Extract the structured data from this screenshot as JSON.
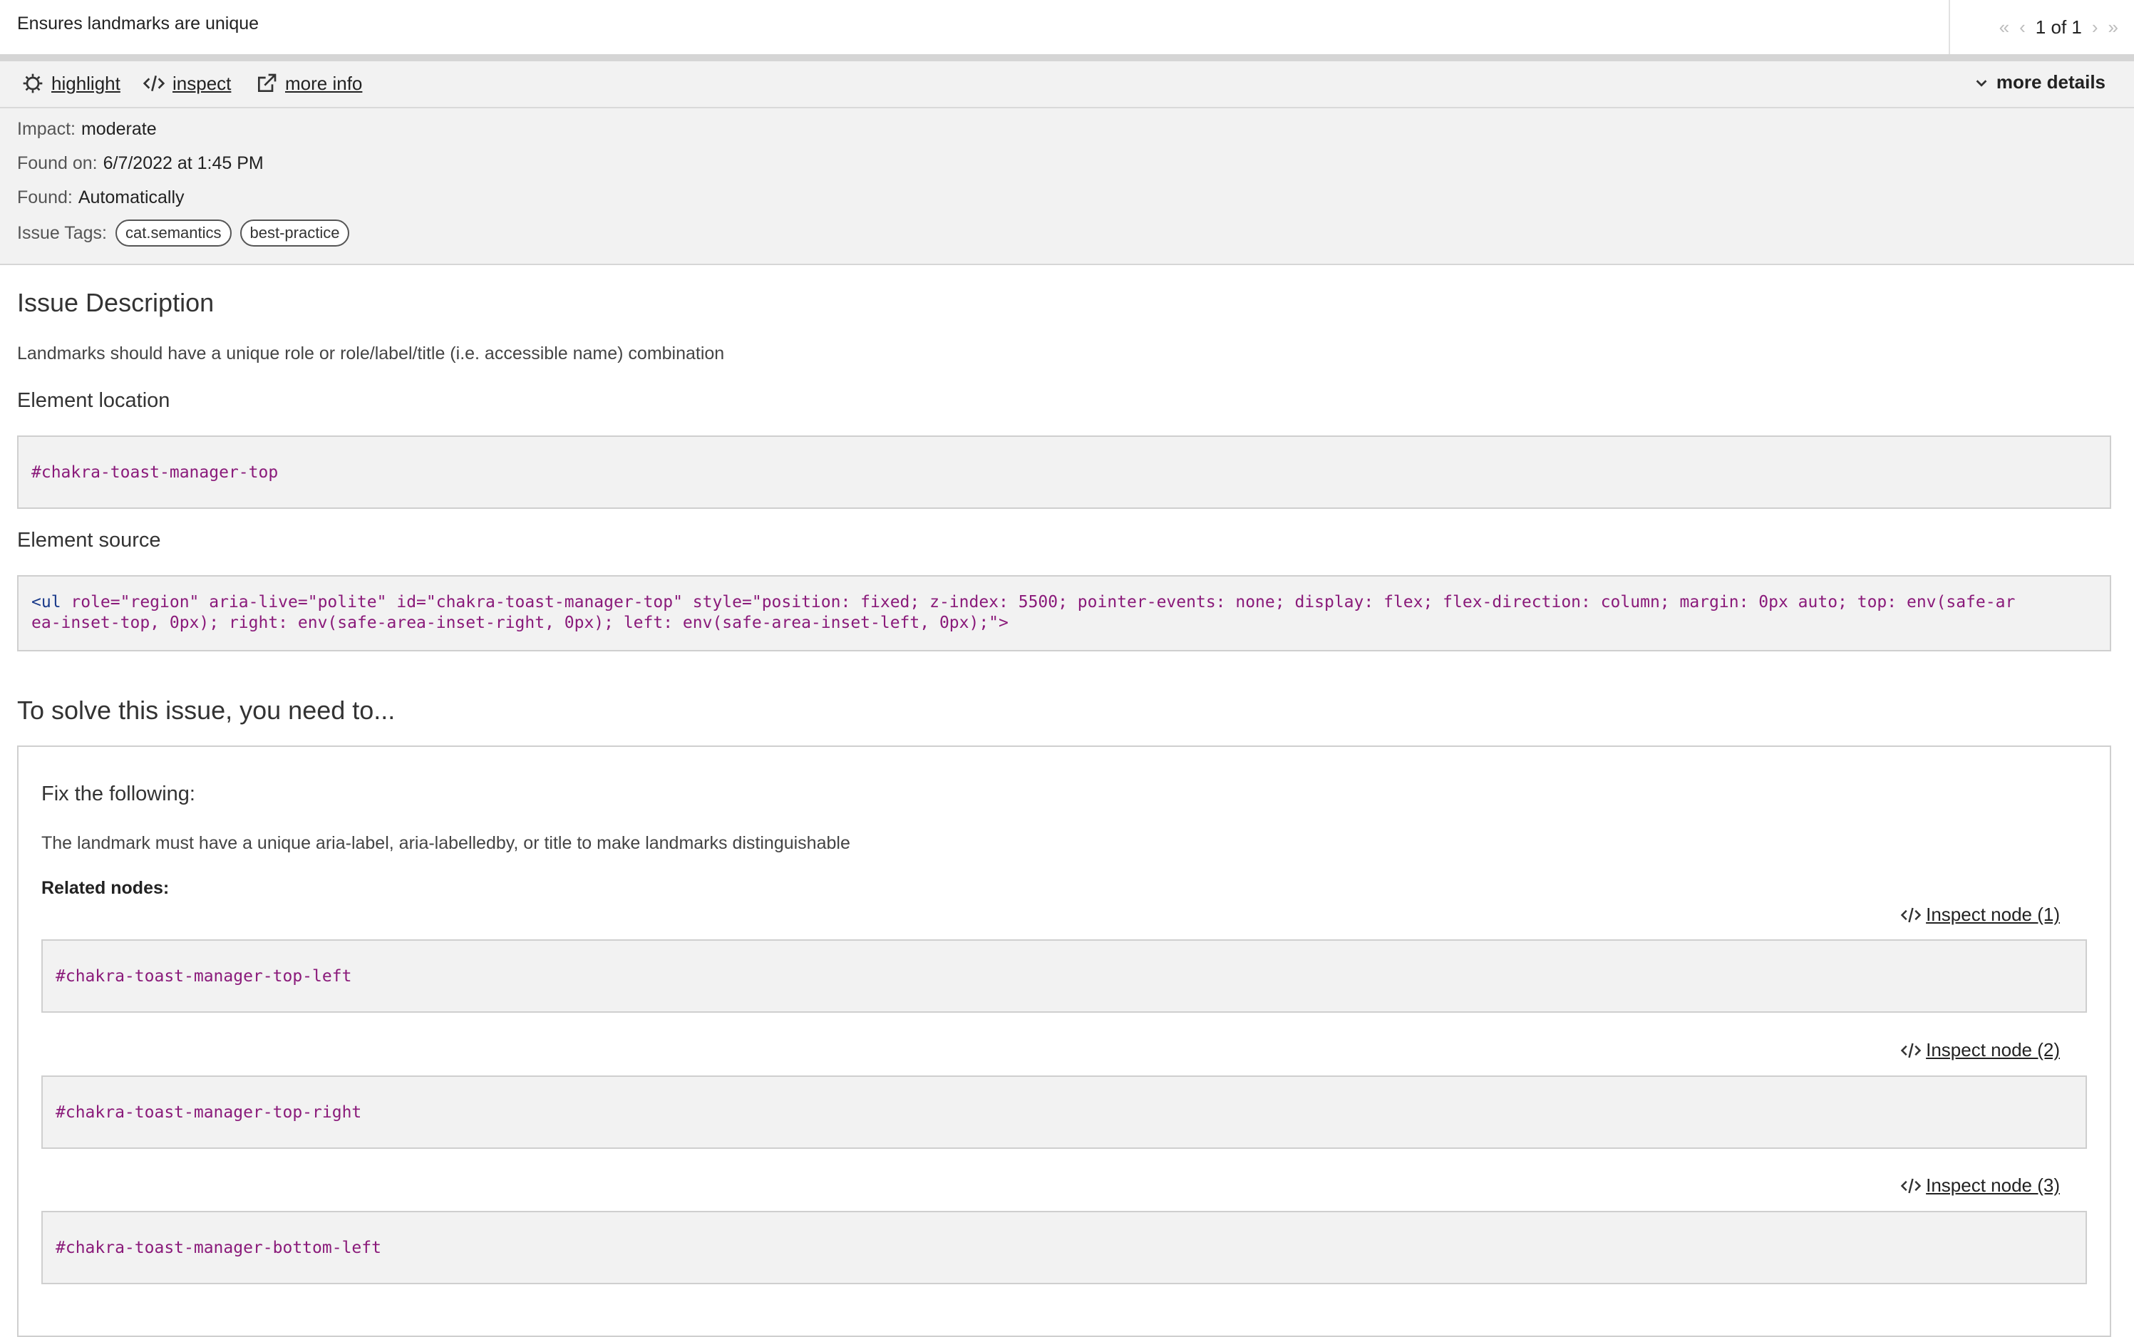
{
  "header": {
    "title": "Ensures landmarks are unique",
    "pager_text": "1 of 1"
  },
  "toolbar": {
    "highlight_label": "highlight",
    "inspect_label": "inspect",
    "more_info_label": "more info",
    "more_details_label": "more details"
  },
  "details": {
    "impact_label": "Impact:",
    "impact_value": "moderate",
    "found_on_label": "Found on:",
    "found_on_value": "6/7/2022 at 1:45 PM",
    "found_label": "Found:",
    "found_value": "Automatically",
    "tags_label": "Issue Tags:",
    "tags": [
      "cat.semantics",
      "best-practice"
    ]
  },
  "description": {
    "heading": "Issue Description",
    "text": "Landmarks should have a unique role or role/label/title (i.e. accessible name) combination"
  },
  "location": {
    "heading": "Element location",
    "selector": "#chakra-toast-manager-top"
  },
  "source": {
    "heading": "Element source",
    "tag_open": "<ul",
    "line1_rest": " role=\"region\" aria-live=\"polite\" id=\"chakra-toast-manager-top\" style=\"position: fixed; z-index: 5500; pointer-events: none; display: flex; flex-direction: column; margin: 0px auto; top: env(safe-ar",
    "line2": "ea-inset-top, 0px); right: env(safe-area-inset-right, 0px); left: env(safe-area-inset-left, 0px);\">"
  },
  "solve": {
    "heading": "To solve this issue, you need to...",
    "fix_heading": "Fix the following:",
    "fix_text": "The landmark must have a unique aria-label, aria-labelledby, or title to make landmarks distinguishable",
    "related_label": "Related nodes:",
    "nodes": [
      {
        "inspect_label": " Inspect node (1)",
        "selector": "#chakra-toast-manager-top-left"
      },
      {
        "inspect_label": " Inspect node (2)",
        "selector": "#chakra-toast-manager-top-right"
      },
      {
        "inspect_label": " Inspect node (3)",
        "selector": "#chakra-toast-manager-bottom-left"
      }
    ]
  },
  "icons": {
    "first": "chevrons-left-icon",
    "prev": "chevron-left-icon",
    "next": "chevron-right-icon",
    "last": "chevrons-right-icon",
    "highlight": "sun-icon",
    "inspect": "code-icon",
    "more_info": "external-link-icon",
    "more_details": "chevron-down-icon"
  },
  "colors": {
    "panel_bg": "#f2f2f2",
    "code_text": "#8a1a7a",
    "tag_name": "#1a3a8a"
  }
}
